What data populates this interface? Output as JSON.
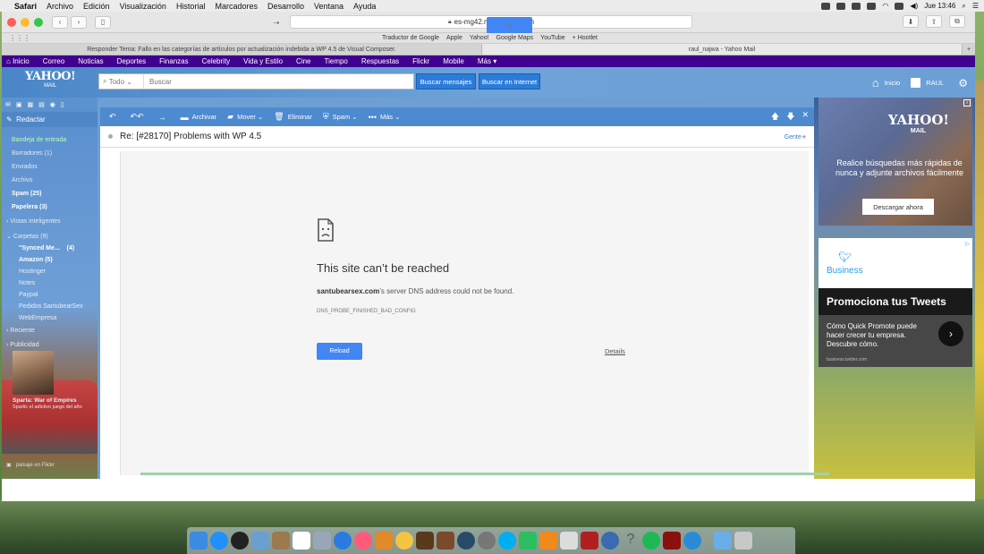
{
  "menubar": {
    "app_name": "Safari",
    "items": [
      "Archivo",
      "Edición",
      "Visualización",
      "Historial",
      "Marcadores",
      "Desarrollo",
      "Ventana",
      "Ayuda"
    ],
    "clock": "Jue 13:46"
  },
  "browser": {
    "url": "es-mg42.mail.yahoo.com",
    "favorites": [
      "Traductor de Google",
      "Apple",
      "Yahoo!",
      "Google Maps",
      "YouTube",
      "+ Hootlet"
    ],
    "tabs": [
      {
        "title": "Responder Tema: Fallo en las categorías de artículos por actualización indebida a WP 4.5 de Visual Composer.",
        "active": false
      },
      {
        "title": "raul_najwa - Yahoo Mail",
        "active": true
      }
    ],
    "new_tab": "+"
  },
  "yahoo_nav": {
    "items": [
      "Inicio",
      "Correo",
      "Noticias",
      "Deportes",
      "Finanzas",
      "Celebrity",
      "Vida y Estilo",
      "Cine",
      "Tiempo",
      "Respuestas",
      "Flickr",
      "Mobile",
      "Más"
    ]
  },
  "header": {
    "logo_line1": "YAHOO!",
    "logo_line2": "MAIL",
    "search_scope": "Todo",
    "search_placeholder": "Buscar",
    "btn_search_mail": "Buscar mensajes",
    "btn_search_web": "Buscar en Internet",
    "home_label": "Inicio",
    "user_name": "RAUL"
  },
  "sidebar": {
    "compose": "Redactar",
    "folders": [
      {
        "label": "Bandeja de entrada",
        "state": "active"
      },
      {
        "label": "Borradores (1)",
        "state": "dim"
      },
      {
        "label": "Enviados",
        "state": "dim"
      },
      {
        "label": "Archivo",
        "state": "dim"
      },
      {
        "label": "Spam (25)",
        "state": "bold"
      },
      {
        "label": "Papelera (3)",
        "state": "bold"
      }
    ],
    "smart_views": "Vistas inteligentes",
    "folders_header": "Carpetas (9)",
    "subfolders": [
      {
        "label": "\"Synced Me...",
        "count": "(4)",
        "bold": true
      },
      {
        "label": "Amazon",
        "count": "(5)",
        "bold": true
      },
      {
        "label": "Hostinger",
        "count": "",
        "bold": false
      },
      {
        "label": "Notes",
        "count": "",
        "bold": false
      },
      {
        "label": "Paypal",
        "count": "",
        "bold": false
      },
      {
        "label": "Pedidos SantubearSex",
        "count": "",
        "bold": false
      },
      {
        "label": "WebEmpresa",
        "count": "",
        "bold": false
      }
    ],
    "recent": "Reciente",
    "ads": "Publicidad",
    "promo_title": "Sparta: War of Empires",
    "promo_text": "Spartic el adictivo juego del año",
    "photo_credit": "paisaje en Flickr"
  },
  "message_toolbar": {
    "archive": "Archivar",
    "move": "Mover",
    "delete": "Eliminar",
    "spam": "Spam",
    "more": "Más"
  },
  "message": {
    "subject": "Re: [#28170] Problems with WP 4.5",
    "people": "Gente"
  },
  "error_page": {
    "title": "This site can’t be reached",
    "domain": "santubearsex.com",
    "desc_rest": "’s server DNS address could not be found.",
    "code": "DNS_PROBE_FINISHED_BAD_CONFIG",
    "reload": "Reload",
    "details": "Details"
  },
  "ad_yahoo": {
    "logo_line1": "YAHOO!",
    "logo_line2": "MAIL",
    "text": "Realice búsquedas más rápidas de nunca y adjunte archivos fácilmente",
    "button": "Descargar ahora"
  },
  "ad_twitter": {
    "brand": "Business",
    "headline": "Promociona tus Tweets",
    "body": "Cómo Quick Promote puede hacer crecer tu empresa. Descubre cómo.",
    "url": "business.twitter.com"
  }
}
